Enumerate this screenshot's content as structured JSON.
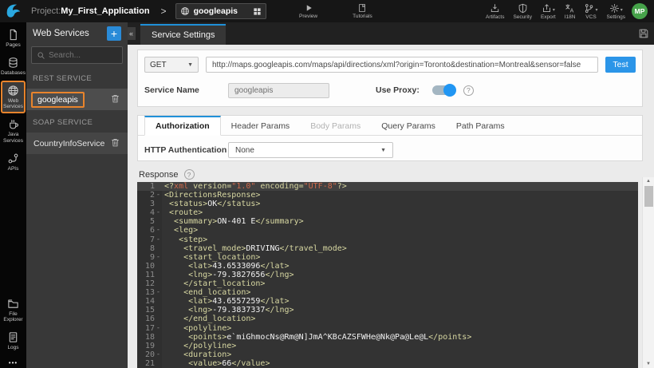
{
  "colors": {
    "accent_blue": "#2b95e8",
    "highlight_orange": "#e8842c",
    "tab_active_blue": "#1f90d8",
    "toggle_blue": "#2196f3",
    "avatar_green": "#46a24a",
    "editor_bg": "#333333",
    "editor_tag": "#d8d8a2",
    "editor_string": "#cf6a4c",
    "editor_text": "#f2f2f2"
  },
  "topbar": {
    "project_label": "Project:",
    "project_name": "My_First_Application",
    "selector_value": "googleapis",
    "preview_label": "Preview",
    "tutorials_label": "Tutorials",
    "right_items": [
      {
        "label": "Artifacts",
        "icon": "artifacts-icon",
        "caret": false
      },
      {
        "label": "Security",
        "icon": "security-icon",
        "caret": false
      },
      {
        "label": "Export",
        "icon": "export-icon",
        "caret": true
      },
      {
        "label": "I18N",
        "icon": "i18n-icon",
        "caret": false
      },
      {
        "label": "VCS",
        "icon": "vcs-icon",
        "caret": true
      },
      {
        "label": "Settings",
        "icon": "settings-icon",
        "caret": true
      }
    ],
    "avatar_initials": "MP"
  },
  "sidebar": {
    "top_items": [
      {
        "label": "Pages",
        "icon": "pages-icon",
        "active": false
      },
      {
        "label": "Databases",
        "icon": "databases-icon",
        "active": false
      },
      {
        "label": "Web Services",
        "icon": "web-services-icon",
        "active": true
      },
      {
        "label": "Java Services",
        "icon": "java-services-icon",
        "active": false
      },
      {
        "label": "APIs",
        "icon": "apis-icon",
        "active": false
      }
    ],
    "bottom_items": [
      {
        "label": "File Explorer",
        "icon": "file-explorer-icon",
        "active": false
      },
      {
        "label": "Logs",
        "icon": "logs-icon",
        "active": false
      }
    ],
    "overflow_label": "•••"
  },
  "panel": {
    "title": "Web Services",
    "add_button": "+",
    "collapse_glyph": "«",
    "search_placeholder": "Search...",
    "sections": [
      {
        "label": "REST SERVICE",
        "items": [
          {
            "name": "googleapis",
            "selected": true
          }
        ]
      },
      {
        "label": "SOAP SERVICE",
        "items": [
          {
            "name": "CountryInfoService",
            "selected": false
          }
        ]
      }
    ]
  },
  "main": {
    "tab_label": "Service Settings",
    "method": "GET",
    "url": "http://maps.googleapis.com/maps/api/directions/xml?origin=Toronto&destination=Montreal&sensor=false",
    "test_label": "Test",
    "service_name_label": "Service Name",
    "service_name_value": "googleapis",
    "use_proxy_label": "Use Proxy:",
    "param_tabs": [
      {
        "label": "Authorization",
        "state": "active"
      },
      {
        "label": "Header Params",
        "state": "normal"
      },
      {
        "label": "Body Params",
        "state": "disabled"
      },
      {
        "label": "Query Params",
        "state": "normal"
      },
      {
        "label": "Path Params",
        "state": "normal"
      }
    ],
    "http_auth_label": "HTTP Authentication",
    "http_auth_value": "None",
    "response_label": "Response"
  },
  "editor": {
    "lines": [
      {
        "n": 1,
        "fold": false,
        "active": true,
        "text": "<?xml version=\"1.0\" encoding=\"UTF-8\"?>"
      },
      {
        "n": 2,
        "fold": true,
        "active": false,
        "text": "<DirectionsResponse>"
      },
      {
        "n": 3,
        "fold": false,
        "active": false,
        "text": " <status>OK</status>"
      },
      {
        "n": 4,
        "fold": true,
        "active": false,
        "text": " <route>"
      },
      {
        "n": 5,
        "fold": false,
        "active": false,
        "text": "  <summary>ON-401 E</summary>"
      },
      {
        "n": 6,
        "fold": true,
        "active": false,
        "text": "  <leg>"
      },
      {
        "n": 7,
        "fold": true,
        "active": false,
        "text": "   <step>"
      },
      {
        "n": 8,
        "fold": false,
        "active": false,
        "text": "    <travel_mode>DRIVING</travel_mode>"
      },
      {
        "n": 9,
        "fold": true,
        "active": false,
        "text": "    <start_location>"
      },
      {
        "n": 10,
        "fold": false,
        "active": false,
        "text": "     <lat>43.6533096</lat>"
      },
      {
        "n": 11,
        "fold": false,
        "active": false,
        "text": "     <lng>-79.3827656</lng>"
      },
      {
        "n": 12,
        "fold": false,
        "active": false,
        "text": "    </start_location>"
      },
      {
        "n": 13,
        "fold": true,
        "active": false,
        "text": "    <end_location>"
      },
      {
        "n": 14,
        "fold": false,
        "active": false,
        "text": "     <lat>43.6557259</lat>"
      },
      {
        "n": 15,
        "fold": false,
        "active": false,
        "text": "     <lng>-79.3837337</lng>"
      },
      {
        "n": 16,
        "fold": false,
        "active": false,
        "text": "    </end_location>"
      },
      {
        "n": 17,
        "fold": true,
        "active": false,
        "text": "    <polyline>"
      },
      {
        "n": 18,
        "fold": false,
        "active": false,
        "text": "     <points>e`miGhmocNs@Rm@N]JmA^KBcAZSFWHe@Nk@Pa@Le@L</points>"
      },
      {
        "n": 19,
        "fold": false,
        "active": false,
        "text": "    </polyline>"
      },
      {
        "n": 20,
        "fold": true,
        "active": false,
        "text": "    <duration>"
      },
      {
        "n": 21,
        "fold": false,
        "active": false,
        "text": "     <value>66</value>"
      }
    ]
  }
}
